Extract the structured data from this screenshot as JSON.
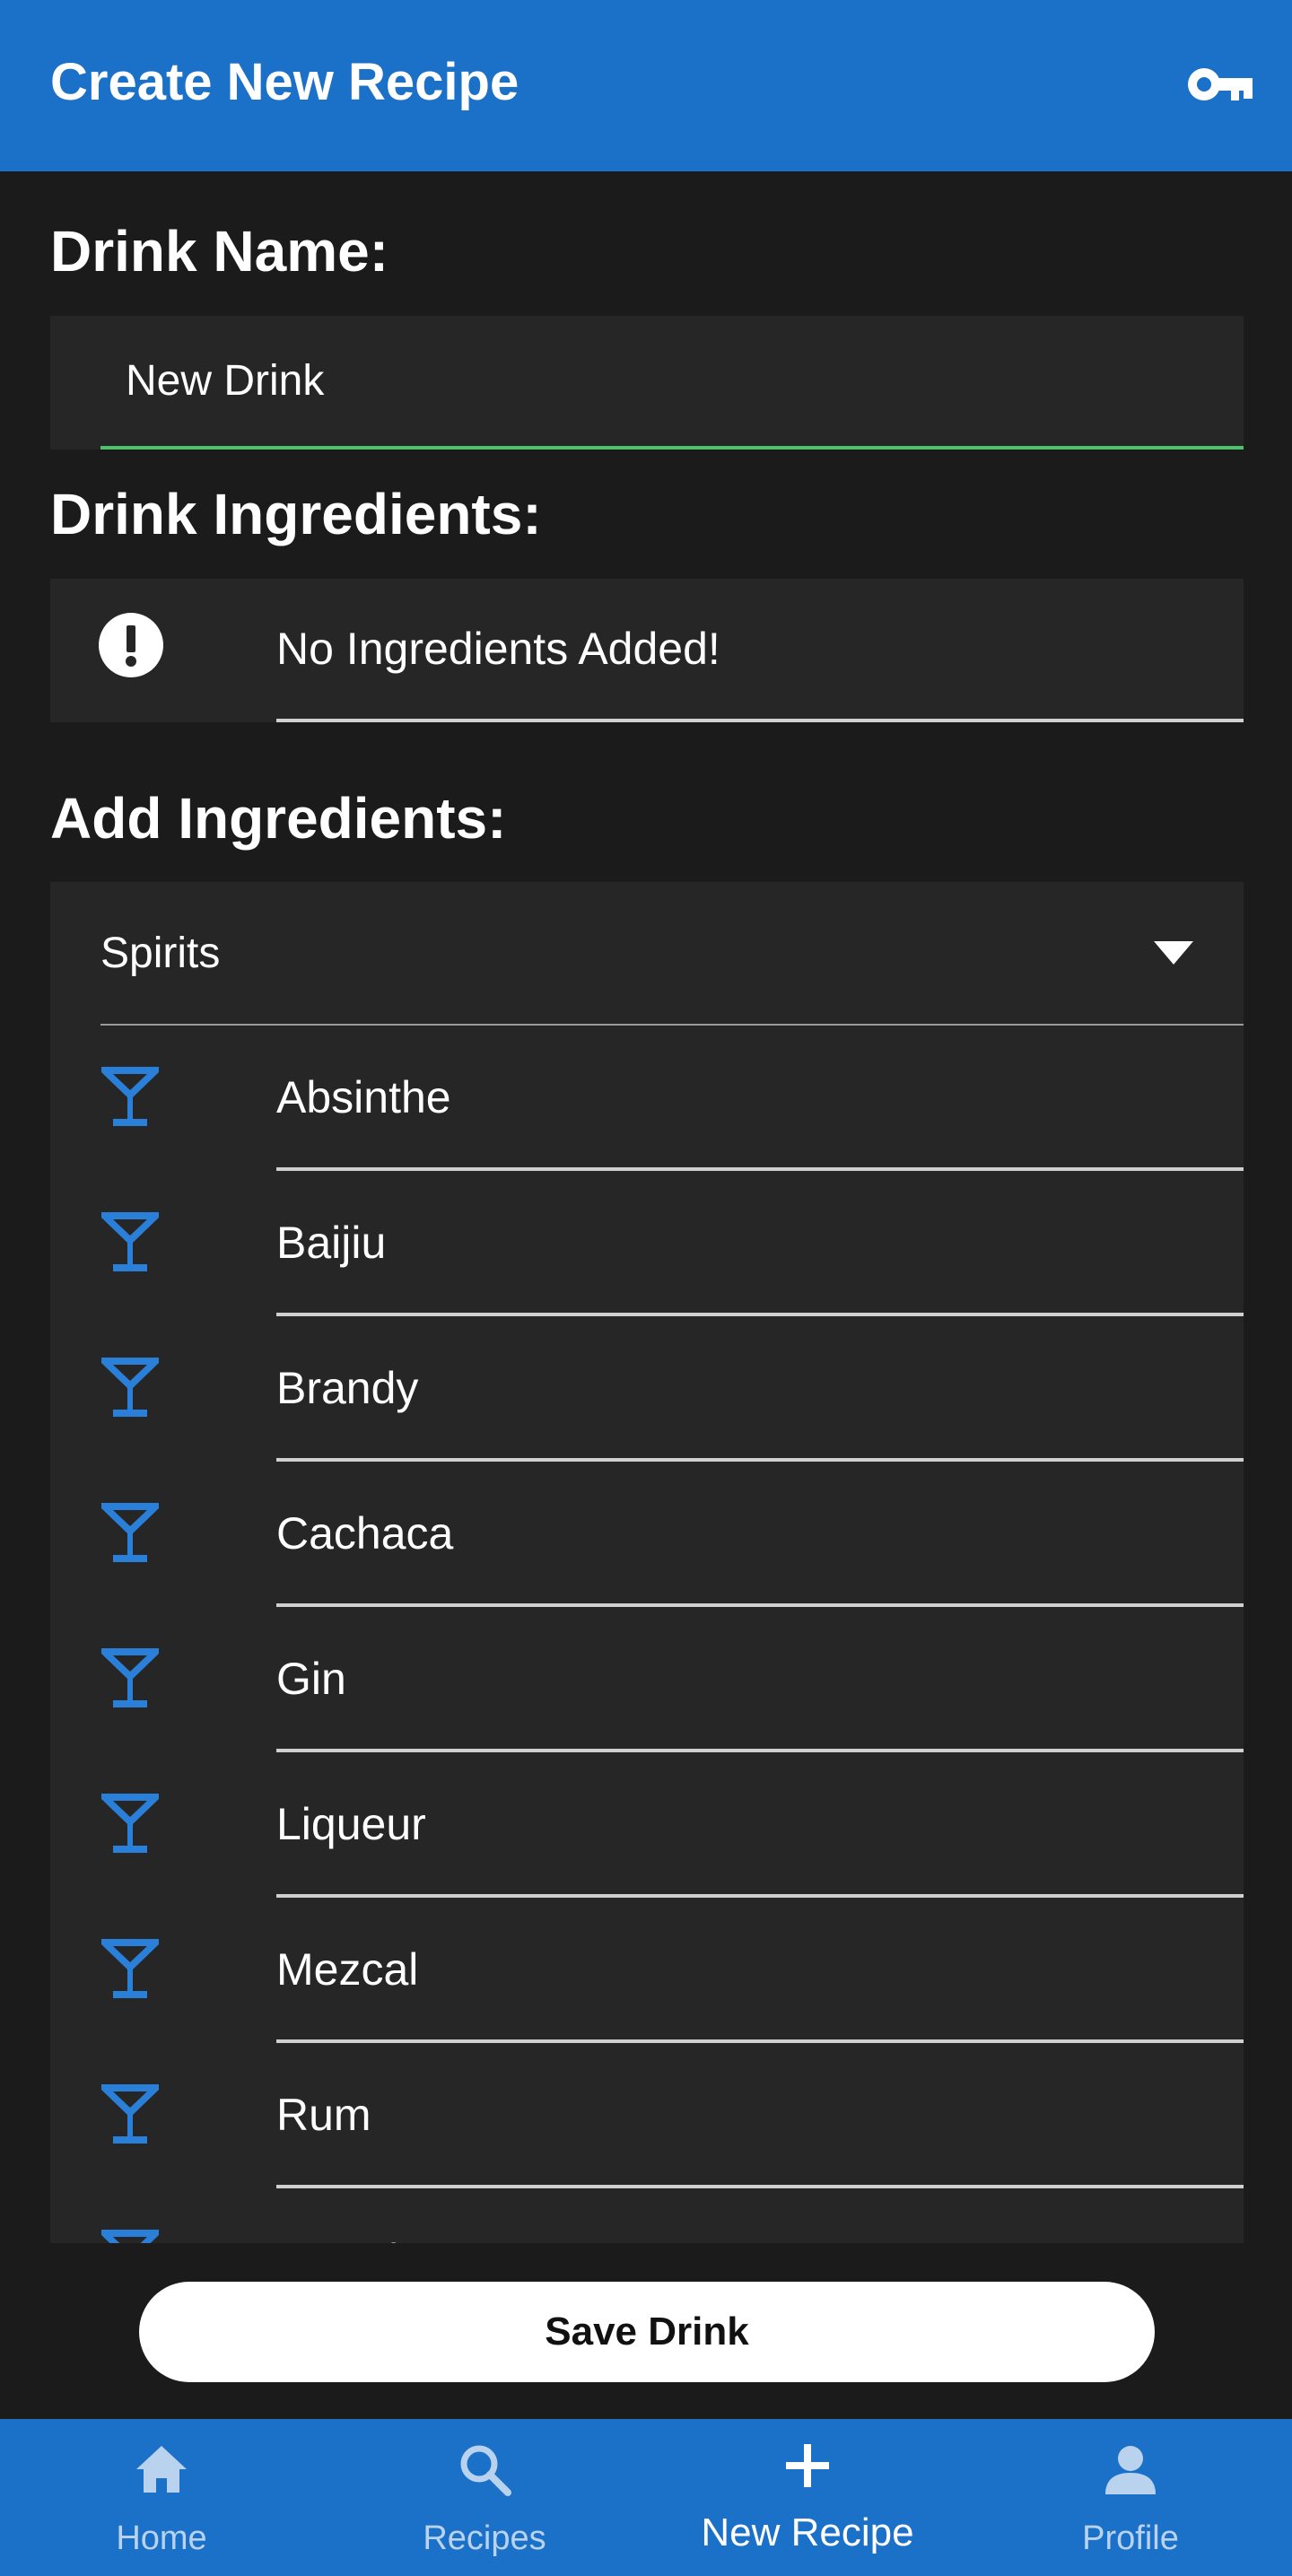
{
  "app_bar": {
    "title": "Create New Recipe",
    "action_icon": "key-icon"
  },
  "drink_name": {
    "label": "Drink Name:",
    "value": "New Drink",
    "underline_color": "#4cc36a"
  },
  "ingredients": {
    "label": "Drink Ingredients:",
    "empty_icon": "alert-circle-icon",
    "empty_message": "No Ingredients Added!"
  },
  "add_ingredients": {
    "label": "Add Ingredients:",
    "category_select": {
      "selected": "Spirits",
      "icon": "chevron-down-icon"
    },
    "items_icon": "cocktail-glass-icon",
    "items": [
      {
        "label": "Absinthe"
      },
      {
        "label": "Baijiu"
      },
      {
        "label": "Brandy"
      },
      {
        "label": "Cachaca"
      },
      {
        "label": "Gin"
      },
      {
        "label": "Liqueur"
      },
      {
        "label": "Mezcal"
      },
      {
        "label": "Rum"
      },
      {
        "label": "Scotch"
      }
    ]
  },
  "save_button": {
    "label": "Save Drink"
  },
  "bottom_nav": {
    "items": [
      {
        "label": "Home",
        "icon": "home-icon",
        "active": false
      },
      {
        "label": "Recipes",
        "icon": "search-icon",
        "active": false
      },
      {
        "label": "New Recipe",
        "icon": "plus-icon",
        "active": true
      },
      {
        "label": "Profile",
        "icon": "person-icon",
        "active": false
      }
    ]
  },
  "colors": {
    "primary": "#1b70c8",
    "background": "#1b1b1b",
    "surface": "#262626",
    "icon_accent": "#2a7fd8"
  }
}
